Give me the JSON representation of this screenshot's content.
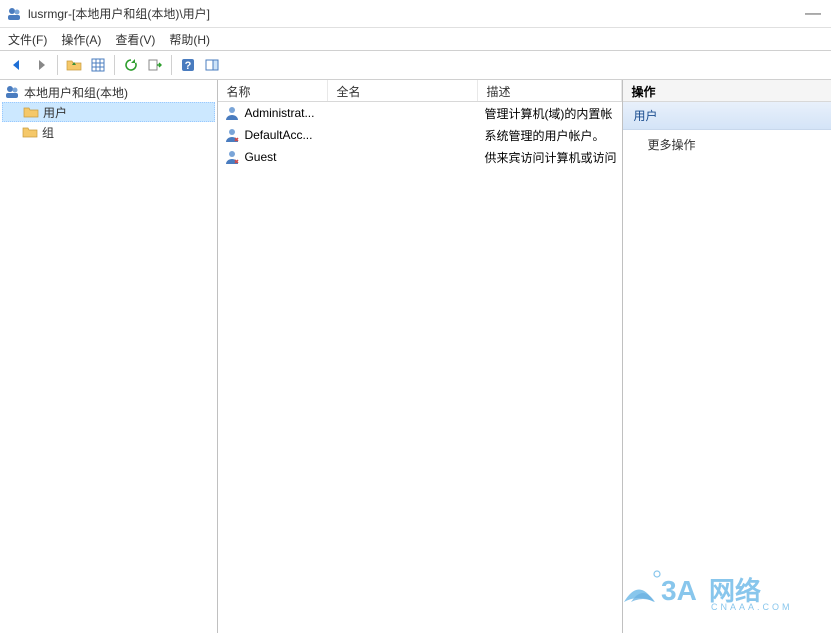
{
  "titlebar": {
    "app": "lusrmgr",
    "sep": " - ",
    "path": "[本地用户和组(本地)\\用户]"
  },
  "menubar": {
    "file": "文件(F)",
    "action": "操作(A)",
    "view": "查看(V)",
    "help": "帮助(H)"
  },
  "tree": {
    "root": "本地用户和组(本地)",
    "users": "用户",
    "groups": "组"
  },
  "list": {
    "cols": {
      "name": "名称",
      "full": "全名",
      "desc": "描述"
    },
    "rows": [
      {
        "name": "Administrat...",
        "full": "",
        "desc": "管理计算机(域)的内置帐"
      },
      {
        "name": "DefaultAcc...",
        "full": "",
        "desc": "系统管理的用户帐户。"
      },
      {
        "name": "Guest",
        "full": "",
        "desc": "供来宾访问计算机或访问"
      }
    ]
  },
  "actions": {
    "header": "操作",
    "section": "用户",
    "more": "更多操作"
  },
  "icons": {
    "app": "lusrmgr-icon",
    "back": "back-icon",
    "forward": "forward-icon",
    "folder-open": "folder-open-icon",
    "grid": "grid-icon",
    "refresh": "refresh-icon",
    "export": "export-icon",
    "help": "help-icon",
    "panel": "panel-icon",
    "users-root": "users-group-icon",
    "folder": "folder-icon",
    "user": "user-icon"
  },
  "watermark": {
    "brand": "3A网络",
    "sub": "CNAAA.COM"
  }
}
